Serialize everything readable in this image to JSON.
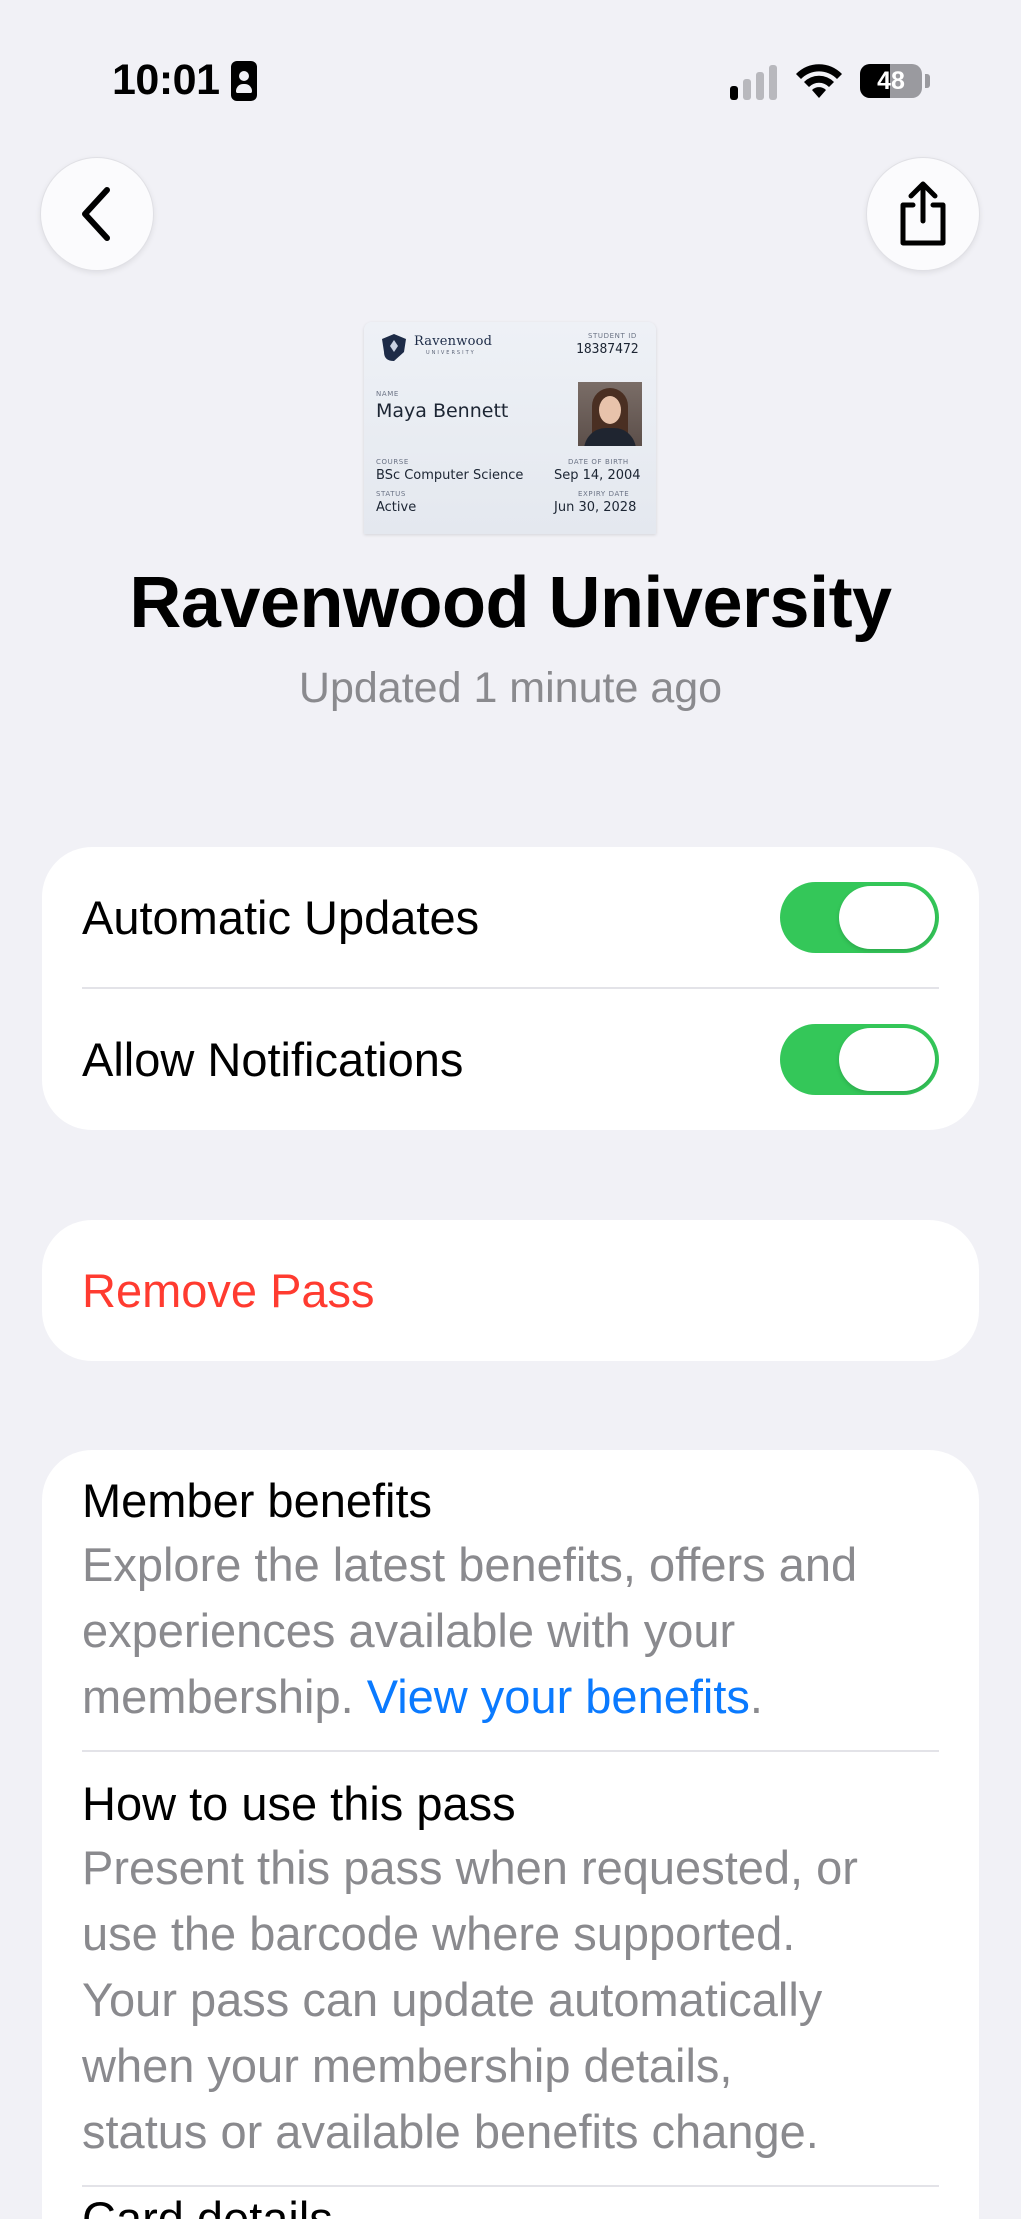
{
  "status_bar": {
    "time": "10:01",
    "battery_percent": "48",
    "signal_bars_active": 1,
    "signal_bars_total": 4
  },
  "nav": {
    "back_icon": "chevron-left-icon",
    "share_icon": "share-icon"
  },
  "pass_card": {
    "brand": "Ravenwood",
    "brand_sub": "UNIVERSITY",
    "student_id_label": "STUDENT ID",
    "student_id": "18387472",
    "name_label": "NAME",
    "name": "Maya Bennett",
    "course_label": "COURSE",
    "course": "BSc Computer Science",
    "dob_label": "DATE OF BIRTH",
    "dob": "Sep 14, 2004",
    "status_label": "STATUS",
    "status": "Active",
    "expiry_label": "EXPIRY DATE",
    "expiry": "Jun 30, 2028"
  },
  "header": {
    "title": "Ravenwood University",
    "updated": "Updated 1 minute ago"
  },
  "settings": {
    "automatic_updates": {
      "label": "Automatic Updates",
      "on": true
    },
    "allow_notifications": {
      "label": "Allow Notifications",
      "on": true
    }
  },
  "remove": {
    "label": "Remove Pass"
  },
  "info": {
    "member_benefits": {
      "title": "Member benefits",
      "body_line1": "Explore the latest benefits, offers and",
      "body_line2": "experiences available with your",
      "body_line3_pre": "membership. ",
      "link": "View your benefits",
      "body_line3_post": "."
    },
    "how_to_use": {
      "title": "How to use this pass",
      "body_line1": "Present this pass when requested, or",
      "body_line2": "use the barcode where supported.",
      "body_line3": "Your pass can update automatically",
      "body_line4": "when your membership details,",
      "body_line5": "status or available benefits change."
    },
    "partial_next": {
      "title": "Card details"
    }
  },
  "colors": {
    "background": "#f1f1f6",
    "toggle_on": "#34c759",
    "destructive": "#ff3b30",
    "link": "#0a7aff",
    "secondary_text": "#8a8a8e"
  }
}
